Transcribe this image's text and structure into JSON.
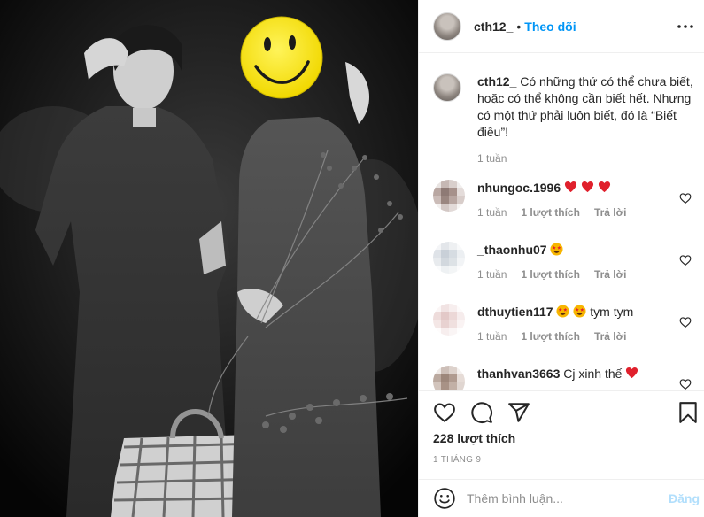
{
  "post": {
    "username": "cth12_",
    "follow_label": "Theo dõi",
    "more_label": "···"
  },
  "caption": {
    "username": "cth12_",
    "text": "Có những thứ có thể chưa biết, hoặc có thể không cần biết hết. Nhưng có một thứ phải luôn biết, đó là “Biết điều”!",
    "time": "1 tuần"
  },
  "comments": [
    {
      "username": "nhungoc.1996",
      "text": "",
      "emoji": [
        "red-heart",
        "red-heart",
        "red-heart"
      ],
      "time": "1 tuần",
      "likes_label": "1 lượt thích",
      "reply_label": "Trả lời"
    },
    {
      "username": "_thaonhu07",
      "text": "",
      "emoji": [
        "star-struck"
      ],
      "time": "1 tuần",
      "likes_label": "1 lượt thích",
      "reply_label": "Trả lời"
    },
    {
      "username": "dthuytien117",
      "text": "tym tym",
      "emoji": [
        "star-struck",
        "star-struck"
      ],
      "time": "1 tuần",
      "likes_label": "1 lượt thích",
      "reply_label": "Trả lời"
    },
    {
      "username": "thanhvan3663",
      "text": "Cj xinh thế",
      "emoji": [
        "red-heart"
      ],
      "time": "",
      "likes_label": "",
      "reply_label": ""
    }
  ],
  "actions": {
    "likes": "228 lượt thích",
    "date": "1 THÁNG 9"
  },
  "add_comment": {
    "placeholder": "Thêm bình luận...",
    "post_label": "Đăng"
  },
  "colors": {
    "link": "#0095f6",
    "muted": "#8e8e8e",
    "heart": "#ed4956",
    "post_disabled": "#b2dffc"
  },
  "icons": [
    "heart-icon",
    "comment-icon",
    "share-icon",
    "bookmark-icon",
    "smile-icon",
    "more-icon"
  ]
}
